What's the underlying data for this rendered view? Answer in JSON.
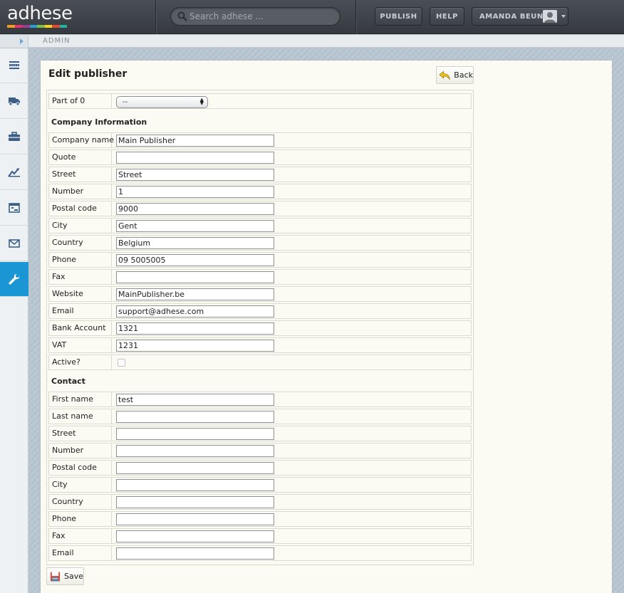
{
  "app": {
    "logo_text": "adhese",
    "logo_stripe_colors": [
      "#f39a1e",
      "#e6306d",
      "#9b3c8e",
      "#2d9bd8",
      "#7cc142",
      "#f7d417",
      "#e64a2e",
      "#22b3a0"
    ]
  },
  "header": {
    "search_placeholder": "Search adhese ...",
    "publish_label": "PUBLISH",
    "help_label": "HELP",
    "user_name": "AMANDA BEUN"
  },
  "breadcrumb": {
    "text": "ADMIN"
  },
  "sidebar": {
    "items": [
      {
        "icon": "inventory-icon"
      },
      {
        "icon": "delivery-truck-icon"
      },
      {
        "icon": "briefcase-icon"
      },
      {
        "icon": "analytics-icon"
      },
      {
        "icon": "layout-icon"
      },
      {
        "icon": "mail-icon"
      },
      {
        "icon": "wrench-icon",
        "active": true
      }
    ],
    "active_color": "#1a96d4"
  },
  "page": {
    "title": "Edit publisher",
    "back_label": "Back",
    "save_label": "Save"
  },
  "form": {
    "part_of_label": "Part of 0",
    "part_of_value": "--",
    "company_section": "Company Information",
    "company_fields": [
      {
        "label": "Company name",
        "value": "Main Publisher"
      },
      {
        "label": "Quote",
        "value": ""
      },
      {
        "label": "Street",
        "value": "Street"
      },
      {
        "label": "Number",
        "value": "1"
      },
      {
        "label": "Postal code",
        "value": "9000"
      },
      {
        "label": "City",
        "value": "Gent"
      },
      {
        "label": "Country",
        "value": "Belgium"
      },
      {
        "label": "Phone",
        "value": "09 5005005"
      },
      {
        "label": "Fax",
        "value": ""
      },
      {
        "label": "Website",
        "value": "MainPublisher.be"
      },
      {
        "label": "Email",
        "value": "support@adhese.com"
      },
      {
        "label": "Bank Account",
        "value": "1321"
      },
      {
        "label": "VAT",
        "value": "1231"
      }
    ],
    "active_label": "Active?",
    "active_checked": false,
    "contact_section": "Contact",
    "contact_fields": [
      {
        "label": "First name",
        "value": "test"
      },
      {
        "label": "Last name",
        "value": ""
      },
      {
        "label": "Street",
        "value": ""
      },
      {
        "label": "Number",
        "value": ""
      },
      {
        "label": "Postal code",
        "value": ""
      },
      {
        "label": "City",
        "value": ""
      },
      {
        "label": "Country",
        "value": ""
      },
      {
        "label": "Phone",
        "value": ""
      },
      {
        "label": "Fax",
        "value": ""
      },
      {
        "label": "Email",
        "value": ""
      }
    ]
  }
}
